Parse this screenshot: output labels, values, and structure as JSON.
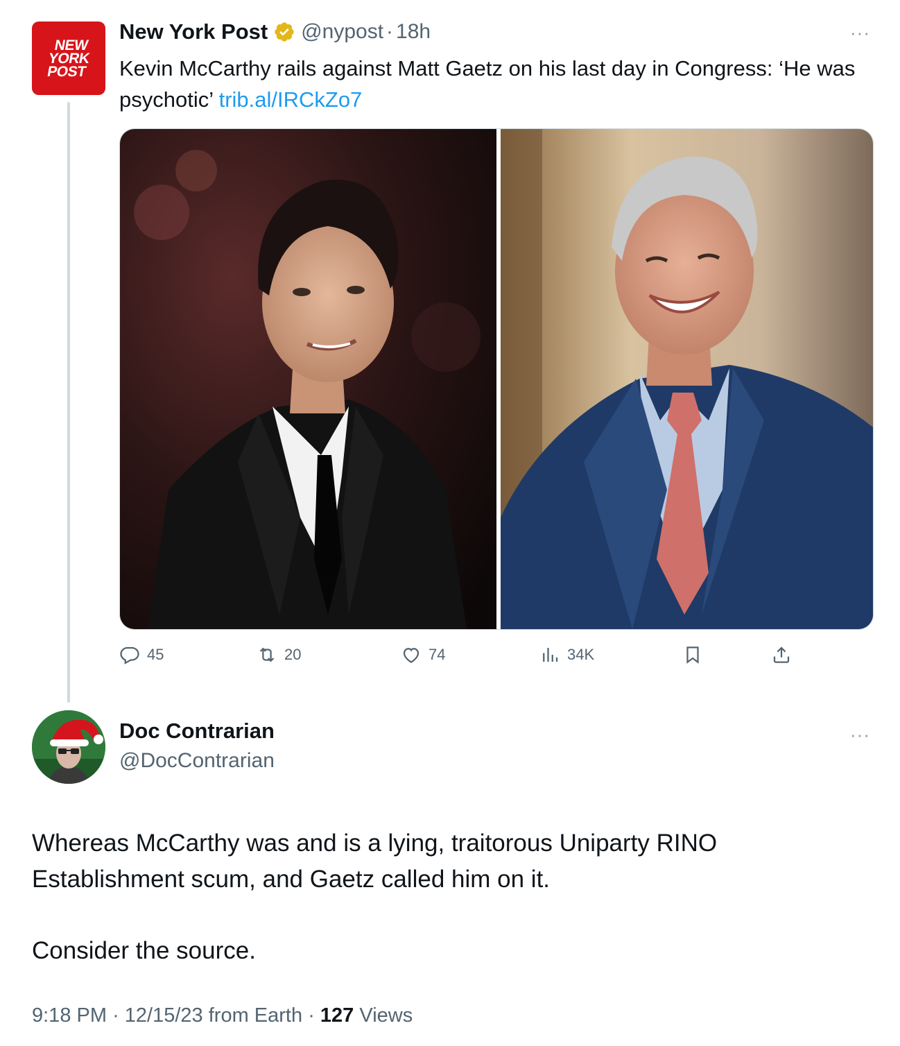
{
  "quoted_tweet": {
    "author_name": "New York Post",
    "author_handle": "@nypost",
    "separator": "·",
    "time_ago": "18h",
    "avatar_text": [
      "NEW",
      "YORK",
      "POST"
    ],
    "text": "Kevin McCarthy rails against Matt Gaetz on his last day in Congress: ‘He was psychotic’ ",
    "link": "trib.al/IRCkZo7",
    "more_label": "···",
    "images": [
      {
        "semantic": "photo-man-black-tuxedo"
      },
      {
        "semantic": "photo-man-blue-suit-smiling"
      }
    ],
    "actions": {
      "replies": "45",
      "reposts": "20",
      "likes": "74",
      "views": "34K"
    }
  },
  "reply_tweet": {
    "author_name": "Doc Contrarian",
    "author_handle": "@DocContrarian",
    "more_label": "···",
    "paragraphs": [
      "Whereas McCarthy was and is a lying, traitorous Uniparty RINO Establishment scum, and Gaetz called him on it.",
      "Consider the source."
    ],
    "meta": {
      "time": "9:18 PM",
      "separator": "·",
      "date": "12/15/23",
      "source": "from Earth",
      "views_count": "127",
      "views_label": "Views"
    }
  },
  "colors": {
    "link": "#1d9bf0",
    "secondary_text": "#536471",
    "verified_gold": "#e2b719",
    "nypost_red": "#d7141a"
  }
}
